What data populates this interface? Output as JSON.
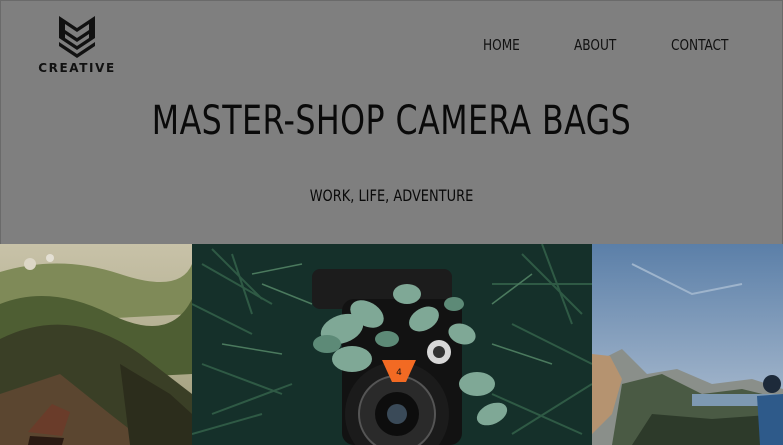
{
  "brand": {
    "logo_text": "CREATIVE",
    "logo_icon": "shield-chevron-logo-icon"
  },
  "nav": {
    "items": [
      {
        "label": "HOME"
      },
      {
        "label": "ABOUT"
      },
      {
        "label": "CONTACT"
      }
    ]
  },
  "hero": {
    "title": "MASTER-SHOP CAMERA BAGS",
    "subtitle": "WORK, LIFE, ADVENTURE"
  },
  "gallery": {
    "images": [
      {
        "subject": "hiking-boots-on-hillside"
      },
      {
        "subject": "vintage-camera-in-foliage"
      },
      {
        "subject": "hiker-at-mountain-lake"
      }
    ]
  },
  "colors": {
    "background": "#7f7f7f",
    "text": "#111111",
    "camera_badge": "#f26a23"
  }
}
